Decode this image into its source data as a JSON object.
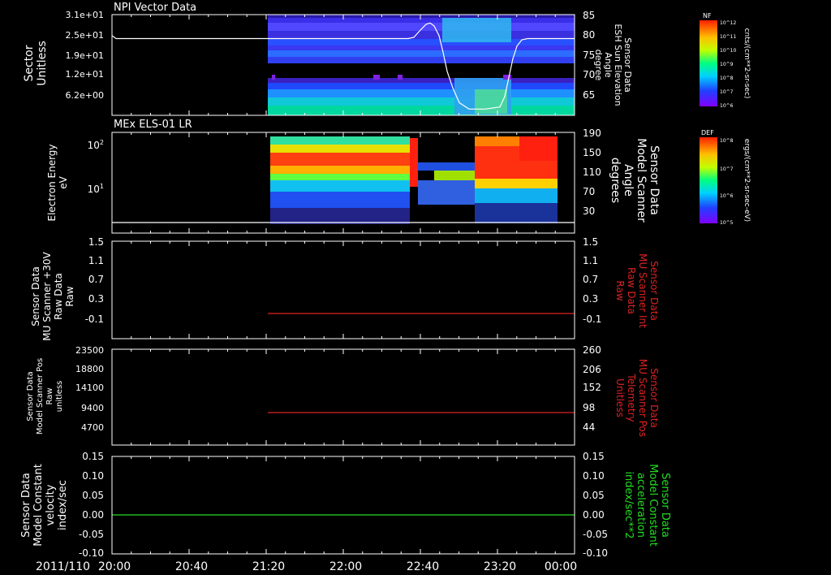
{
  "date_label": "2011/110",
  "time_ticks": [
    "20:00",
    "20:40",
    "21:20",
    "22:00",
    "22:40",
    "23:20",
    "00:00"
  ],
  "chart_data": [
    {
      "type": "heatmap",
      "title": "NPI Vector Data",
      "ylabel_left": [
        "Sector",
        "Unitless"
      ],
      "yticks_left": [
        "3.1e+01",
        "2.5e+01",
        "1.9e+01",
        "1.2e+01",
        "6.2e+00"
      ],
      "ylabel_right": [
        "Sensor Data",
        "ESH Sun Elevation",
        "Angle",
        "degree"
      ],
      "yticks_right": [
        "85",
        "80",
        "75",
        "70",
        "65"
      ],
      "ylim_right": [
        61,
        85
      ],
      "data_start": "21:20",
      "overlay_series": {
        "name": "ESH Sun Elevation Angle",
        "color": "#ffffff",
        "points": [
          [
            0,
            80
          ],
          [
            5,
            79.3
          ],
          [
            190,
            79.3
          ],
          [
            365,
            79.3
          ],
          [
            372,
            79.6
          ],
          [
            380,
            81.3
          ],
          [
            387,
            82.7
          ],
          [
            392,
            83
          ],
          [
            397,
            82.3
          ],
          [
            403,
            80
          ],
          [
            408,
            76
          ],
          [
            413,
            71.5
          ],
          [
            420,
            67.5
          ],
          [
            428,
            64
          ],
          [
            440,
            62.5
          ],
          [
            460,
            62.5
          ],
          [
            478,
            63
          ],
          [
            484,
            65.5
          ],
          [
            489,
            70
          ],
          [
            494,
            74.5
          ],
          [
            499,
            77.5
          ],
          [
            505,
            79
          ],
          [
            512,
            79.3
          ],
          [
            570,
            79.3
          ]
        ]
      },
      "colorbar": {
        "label": "NF",
        "unit": "cnts/(cm**2-sr-sec)",
        "ticks": [
          "10^12",
          "10^11",
          "10^10",
          "10^9",
          "10^8",
          "10^7",
          "10^6"
        ]
      }
    },
    {
      "type": "heatmap",
      "title": "MEx ELS-01 LR",
      "ylabel_left": [
        "Electron Energy",
        "eV"
      ],
      "yticks_left": [
        "10^2",
        "10^1"
      ],
      "ylabel_right": [
        "Sensor Data",
        "Model Scanner",
        "Angle",
        "degrees"
      ],
      "yticks_right": [
        "190",
        "150",
        "110",
        "70",
        "30"
      ],
      "ylim_right": [
        0,
        190
      ],
      "data_start": "21:20",
      "overlay_series": {
        "name": "Model Scanner Angle",
        "color": "#ffffff",
        "constant": 10
      },
      "colorbar": {
        "label": "DEF",
        "unit": "ergs/(cm**2-sr-sec-eV)",
        "ticks": [
          "10^8",
          "10^7",
          "10^6",
          "10^5"
        ]
      }
    },
    {
      "type": "line",
      "ylabel_left": [
        "Sensor Data",
        "MU Scanner +30V",
        "Raw Data",
        "Raw"
      ],
      "yticks_left": [
        "1.5",
        "1.1",
        "0.7",
        "0.3",
        "-0.1"
      ],
      "ylim_left": [
        -0.34,
        1.5
      ],
      "ylabel_right": [
        "Sensor Data",
        "MU Scanner Int",
        "Raw Data",
        "Raw"
      ],
      "yticks_right": [
        "1.5",
        "1.1",
        "0.7",
        "0.3",
        "-0.1"
      ],
      "series": [
        {
          "color": "#dd2222",
          "x_start": "21:20",
          "x_end": "00:00",
          "value": 0.0
        }
      ]
    },
    {
      "type": "line",
      "ylabel_left": [
        "Sensor Data",
        "Model Scanner Pos",
        "Raw",
        "unitless"
      ],
      "yticks_left": [
        "23500",
        "18800",
        "14100",
        "9400",
        "4700"
      ],
      "ylim_left": [
        0,
        23500
      ],
      "ylabel_right": [
        "Sensor Data",
        "MU Scanner Pos",
        "Telemetry",
        "Unitless"
      ],
      "yticks_right": [
        "260",
        "206",
        "152",
        "98",
        "44"
      ],
      "series": [
        {
          "color": "#dd2222",
          "x_start": "21:20",
          "x_end": "00:00",
          "value": 8200
        }
      ]
    },
    {
      "type": "line",
      "ylabel_left": [
        "Sensor Data",
        "Model Constant",
        "velocity",
        "index/sec"
      ],
      "yticks_left": [
        "0.15",
        "0.10",
        "0.05",
        "0.00",
        "-0.05",
        "-0.10"
      ],
      "ylim_left": [
        -0.1,
        0.15
      ],
      "ylabel_right": [
        "Sensor Data",
        "Model Constant",
        "acceleration",
        "index/sec**2"
      ],
      "yticks_right": [
        "0.15",
        "0.10",
        "0.05",
        "0.00",
        "-0.05",
        "-0.10"
      ],
      "series": [
        {
          "color": "#22dd22",
          "x_start": "20:00",
          "x_end": "00:00",
          "value": 0.0
        }
      ]
    }
  ],
  "colors": {
    "background": "#000000",
    "axes": "#ffffff",
    "red_trace": "#dd2222",
    "green_trace": "#22dd22"
  }
}
